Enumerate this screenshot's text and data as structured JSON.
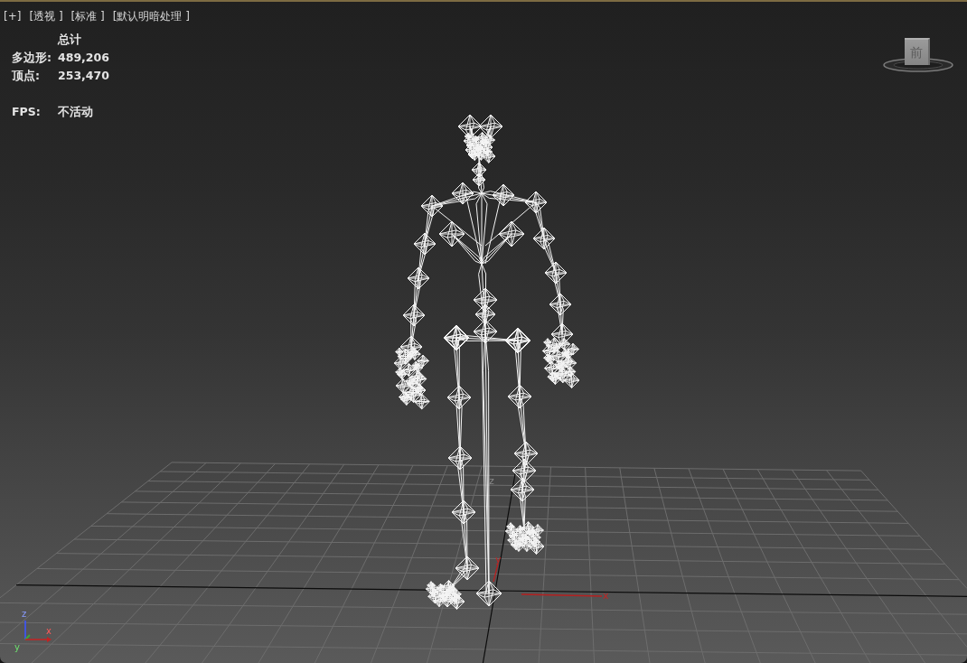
{
  "viewport": {
    "active": true,
    "menus": [
      {
        "label": "[+]"
      },
      {
        "label": "[透视 ]"
      },
      {
        "label": "[标准 ]"
      },
      {
        "label": "[默认明暗处理 ]"
      }
    ]
  },
  "statistics": {
    "header": "总计",
    "counts": [
      {
        "label": "多边形:",
        "value": "489,206"
      },
      {
        "label": "顶点:",
        "value": "253,470"
      }
    ],
    "fps": {
      "label": "FPS:",
      "value": "不活动"
    }
  },
  "view_cube": {
    "face": "前"
  },
  "transform_gizmo": [
    {
      "kind": "z",
      "label": "z"
    },
    {
      "kind": "y",
      "label": "y"
    },
    {
      "kind": "x",
      "label": "x"
    }
  ],
  "world_axes": [
    {
      "kind": "z",
      "label": "z"
    },
    {
      "kind": "y",
      "label": "y"
    },
    {
      "kind": "x",
      "label": "x"
    }
  ]
}
